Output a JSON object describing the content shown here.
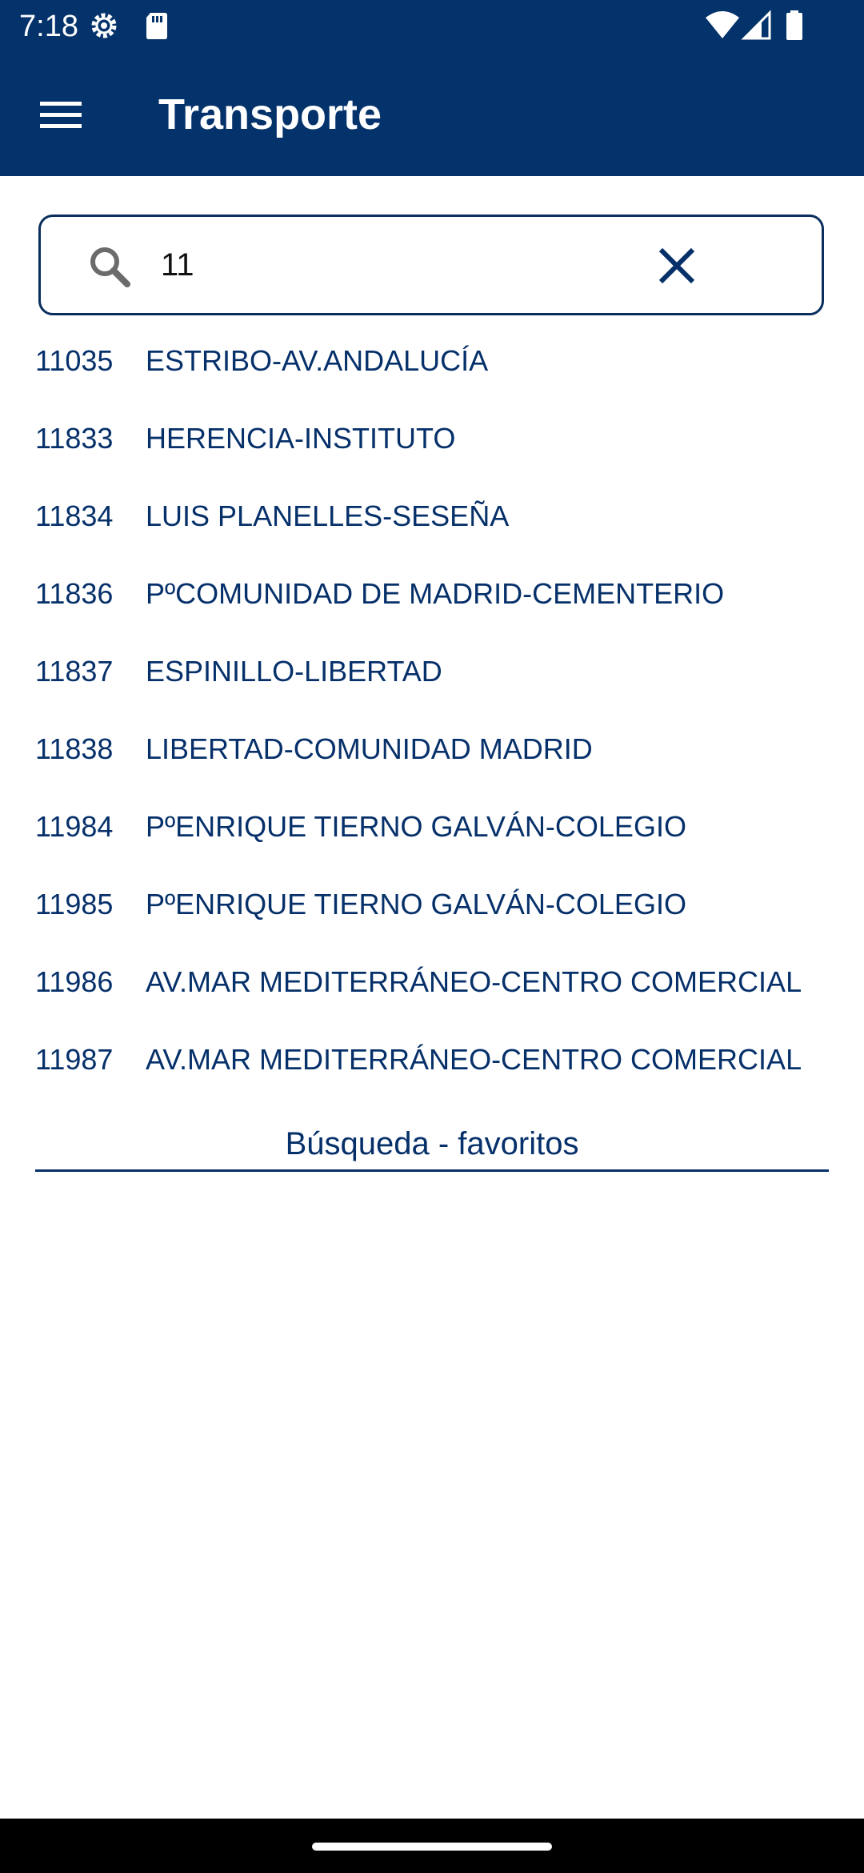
{
  "status_bar": {
    "time": "7:18",
    "icons": [
      "settings-icon",
      "sd-card-icon",
      "wifi-icon",
      "signal-icon",
      "battery-icon"
    ]
  },
  "app_bar": {
    "title": "Transporte",
    "menu_icon": "hamburger-menu-icon",
    "background_color": "#04326a"
  },
  "search": {
    "value": "11",
    "search_icon": "search-icon",
    "clear_icon": "close-icon"
  },
  "results": [
    {
      "code": "11035",
      "name": "ESTRIBO-AV.ANDALUCÍA"
    },
    {
      "code": "11833",
      "name": "HERENCIA-INSTITUTO"
    },
    {
      "code": "11834",
      "name": "LUIS PLANELLES-SESEÑA"
    },
    {
      "code": "11836",
      "name": "PºCOMUNIDAD DE MADRID-CEMENTERIO"
    },
    {
      "code": "11837",
      "name": "ESPINILLO-LIBERTAD"
    },
    {
      "code": "11838",
      "name": "LIBERTAD-COMUNIDAD MADRID"
    },
    {
      "code": "11984",
      "name": "PºENRIQUE TIERNO GALVÁN-COLEGIO"
    },
    {
      "code": "11985",
      "name": "PºENRIQUE TIERNO GALVÁN-COLEGIO"
    },
    {
      "code": "11986",
      "name": "AV.MAR MEDITERRÁNEO-CENTRO COMERCIAL"
    },
    {
      "code": "11987",
      "name": "AV.MAR MEDITERRÁNEO-CENTRO COMERCIAL"
    }
  ],
  "tabs": {
    "favorites_label": "Búsqueda - favoritos"
  },
  "colors": {
    "primary": "#04326a",
    "text": "#06306a"
  }
}
